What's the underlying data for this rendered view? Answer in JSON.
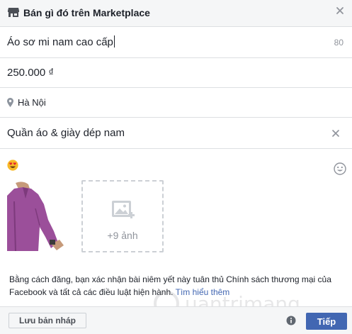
{
  "header": {
    "title": "Bán gì đó trên Marketplace",
    "icon": "store-icon",
    "close_icon": "close-icon"
  },
  "form": {
    "title_value": "Áo sơ mi nam cao cấp",
    "char_count": "80",
    "price_value": "250.000 ₫",
    "location_value": "Hà Nội",
    "category_value": "Quần áo & giày dép nam"
  },
  "photos": {
    "selected_emoji": "heart-eyes-emoji",
    "add_more_label": "+9 ảnh"
  },
  "notice": {
    "text_before_link": "Bằng cách đăng, bạn xác nhận bài niêm yết này tuân thủ Chính sách thương mại của Facebook và tất cả các điều luật hiện hành. ",
    "link_text": "Tìm hiểu thêm"
  },
  "watermark": {
    "text": "uantrimang"
  },
  "footer": {
    "draft_label": "Lưu bản nháp",
    "next_label": "Tiếp"
  },
  "colors": {
    "accent": "#4267b2",
    "header_bg": "#f5f6f7",
    "border": "#dddfe2",
    "muted_text": "#90949c"
  }
}
